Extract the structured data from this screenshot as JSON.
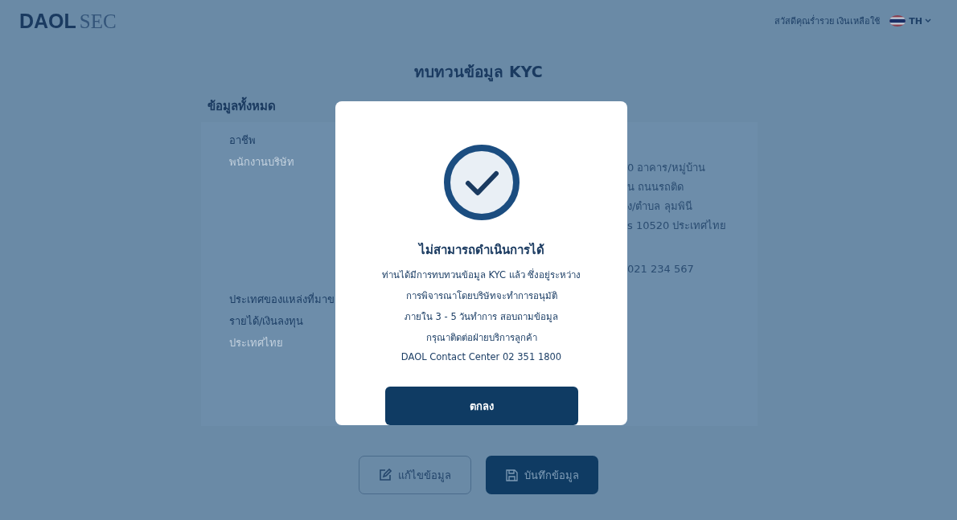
{
  "header": {
    "logo": {
      "primary": "DAOL",
      "secondary": "SEC"
    },
    "greeting": "สวัสดีคุณร่ำรวย เงินเหลือใช้",
    "language": "TH"
  },
  "page_title": "ทบทวนข้อมูล KYC",
  "section_title": "ข้อมูลทั้งหมด",
  "left_fields": [
    {
      "label": "อาชีพ",
      "value": "พนักงานบริษัท"
    },
    {
      "label": "ประเทศของแหล่งที่มาข",
      "label_2": "รายได้/เงินลงทุน",
      "value": "ประเทศไทย"
    }
  ],
  "right_lines": [
    "0 อาคาร/หมู่บ้าน",
    "น ถนนรถติด",
    "ง/ตำบล ลุมพินี",
    "s 10520 ประเทศไทย",
    "021 234 567"
  ],
  "actions": [
    {
      "label": "แก้ไขข้อมูล",
      "kind": "outline"
    },
    {
      "label": "บันทึกข้อมูล",
      "kind": "solid"
    }
  ],
  "dialog": {
    "title": "ไม่สามารถดำเนินการได้",
    "message": [
      "ท่านได้มีการทบทวนข้อมูล KYC แล้ว ซึ่งอยู่ระหว่าง",
      "การพิจารณาโดยบริษัทจะทำการอนุมัติ",
      "ภายใน 3 - 5 วันทำการ สอบถามข้อมูล",
      "กรุณาติดต่อฝ่ายบริการลูกค้า",
      "DAOL Contact Center 02 351 1800"
    ],
    "button": "ตกลง"
  }
}
